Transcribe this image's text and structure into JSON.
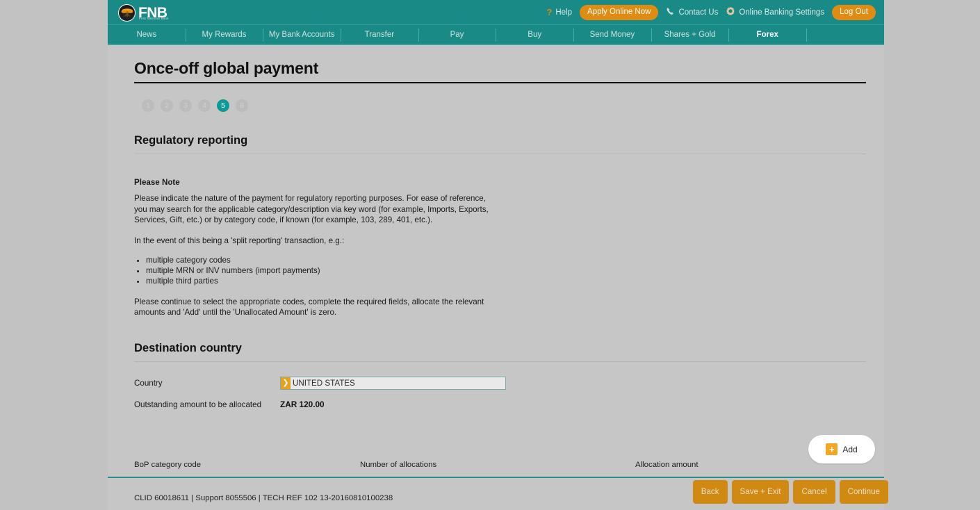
{
  "header": {
    "logo_text": "FNB",
    "logo_tagline": "First National Bank",
    "help_label": "Help",
    "help_icon": "question-mark-icon",
    "apply_label": "Apply Online Now",
    "contact_label": "Contact Us",
    "contact_icon": "phone-icon",
    "settings_label": "Online Banking Settings",
    "settings_icon": "gear-icon",
    "logout_label": "Log Out"
  },
  "nav": {
    "items": [
      {
        "label": "News",
        "active": false
      },
      {
        "label": "My Rewards",
        "active": false
      },
      {
        "label": "My Bank Accounts",
        "active": false
      },
      {
        "label": "Transfer",
        "active": false
      },
      {
        "label": "Pay",
        "active": false
      },
      {
        "label": "Buy",
        "active": false
      },
      {
        "label": "Send Money",
        "active": false
      },
      {
        "label": "Shares + Gold",
        "active": false
      },
      {
        "label": "Forex",
        "active": true
      }
    ]
  },
  "page": {
    "title": "Once-off global payment",
    "steps": [
      "1",
      "2",
      "3",
      "4",
      "5",
      "6"
    ],
    "active_step": 5,
    "section_title": "Regulatory reporting"
  },
  "note": {
    "heading": "Please Note",
    "para1": "Please indicate the nature of the payment for regulatory reporting purposes. For ease of reference, you may search for the applicable category/description via key word (for example, Imports, Exports, Services, Gift, etc.) or by category code, if known (for example, 103, 289, 401, etc.).",
    "para2": "In the event of this being a 'split reporting' transaction, e.g.:",
    "bullets": [
      "multiple category codes",
      "multiple MRN or INV numbers (import payments)",
      "multiple third parties"
    ],
    "para3": "Please continue to select the appropriate codes, complete the required fields, allocate the relevant amounts and 'Add' until the 'Unallocated Amount' is zero."
  },
  "destination": {
    "section_title": "Destination country",
    "country_label": "Country",
    "country_value": "UNITED STATES",
    "country_chevron_icon": "chevron-right-icon",
    "outstanding_label": "Outstanding amount to be allocated",
    "outstanding_value": "ZAR 120.00"
  },
  "add_button": {
    "label": "Add",
    "icon": "plus-icon"
  },
  "table": {
    "columns": [
      "BoP category code",
      "Number of allocations",
      "Allocation amount"
    ],
    "rows": []
  },
  "footer": {
    "info": "CLID 60018611 | Support 8055506 | TECH REF 102 13-20160810100238",
    "buttons": [
      "Back",
      "Save + Exit",
      "Cancel",
      "Continue"
    ]
  },
  "colors": {
    "teal": "#1a8a87",
    "teal_accent": "#0b9a96",
    "orange": "#e08b12",
    "orange_light": "#f5a623",
    "page_bg": "#c2c2c2",
    "content_bg": "#c6c6c6"
  }
}
